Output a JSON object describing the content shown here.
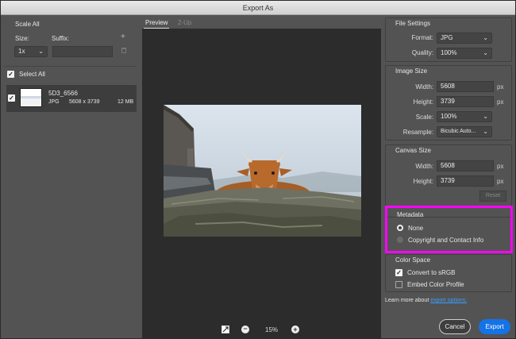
{
  "window": {
    "title": "Export As"
  },
  "left": {
    "scale_all_label": "Scale All",
    "size_label": "Size:",
    "suffix_label": "Suffix:",
    "size_value": "1x",
    "suffix_value": "",
    "select_all_label": "Select All",
    "asset": {
      "name": "5D3_6566",
      "format": "JPG",
      "dimensions": "5608 x 3739",
      "filesize": "12 MB"
    }
  },
  "center": {
    "tabs": [
      "Preview",
      "2-Up"
    ],
    "active_tab": "Preview",
    "zoom": "15%"
  },
  "file_settings": {
    "title": "File Settings",
    "format_label": "Format:",
    "format_value": "JPG",
    "quality_label": "Quality:",
    "quality_value": "100%"
  },
  "image_size": {
    "title": "Image Size",
    "width_label": "Width:",
    "width_value": "5608",
    "width_unit": "px",
    "height_label": "Height:",
    "height_value": "3739",
    "height_unit": "px",
    "scale_label": "Scale:",
    "scale_value": "100%",
    "resample_label": "Resample:",
    "resample_value": "Bicubic Auto..."
  },
  "canvas_size": {
    "title": "Canvas Size",
    "width_label": "Width:",
    "width_value": "5608",
    "width_unit": "px",
    "height_label": "Height:",
    "height_value": "3739",
    "height_unit": "px",
    "reset_label": "Reset"
  },
  "metadata": {
    "title": "Metadata",
    "options": [
      "None",
      "Copyright and Contact Info"
    ],
    "selected": "None",
    "highlight_color": "#ff00ff"
  },
  "color_space": {
    "title": "Color Space",
    "convert_label": "Convert to sRGB",
    "convert_checked": true,
    "embed_label": "Embed Color Profile",
    "embed_checked": false
  },
  "footer": {
    "learn_more_label": "Learn more about",
    "learn_more_link": "export options.",
    "cancel_label": "Cancel",
    "export_label": "Export",
    "accent": "#1473e6"
  },
  "icons": [
    "plus-icon",
    "trash-icon",
    "chevron-down-icon",
    "checkbox-icon",
    "fit-to-view-icon",
    "zoom-out-icon",
    "zoom-in-icon"
  ]
}
